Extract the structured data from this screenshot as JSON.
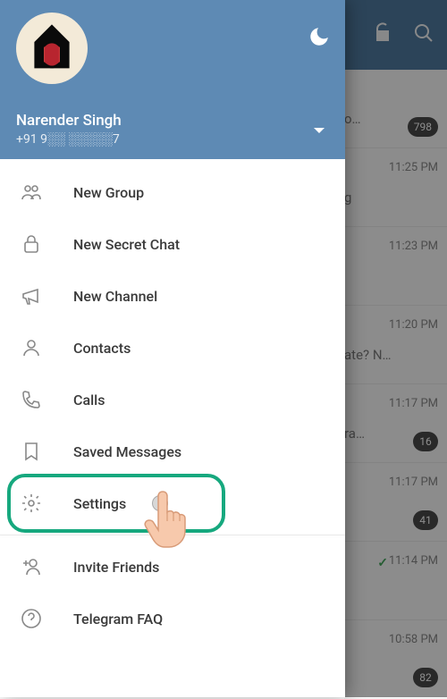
{
  "header": {
    "user_name": "Narender Singh",
    "user_phone": "+91 9░░ ░░░░░7"
  },
  "menu": {
    "new_group": "New Group",
    "new_secret_chat": "New Secret Chat",
    "new_channel": "New Channel",
    "contacts": "Contacts",
    "calls": "Calls",
    "saved_messages": "Saved Messages",
    "settings": "Settings",
    "invite_friends": "Invite Friends",
    "telegram_faq": "Telegram FAQ"
  },
  "chats": [
    {
      "time": "",
      "peek": "o…",
      "badge": "798"
    },
    {
      "time": "11:25 PM",
      "peek": "g",
      "badge": ""
    },
    {
      "time": "11:23 PM",
      "peek": "",
      "badge": ""
    },
    {
      "time": "11:20 PM",
      "peek": "ate? N…",
      "badge": ""
    },
    {
      "time": "11:17 PM",
      "peek": "ra…",
      "badge": "16"
    },
    {
      "time": "11:17 PM",
      "peek": "",
      "badge": "41"
    },
    {
      "time": "11:14 PM",
      "peek": "",
      "badge": "",
      "checked": true
    },
    {
      "time": "10:58 PM",
      "peek": "",
      "badge": "82"
    }
  ]
}
